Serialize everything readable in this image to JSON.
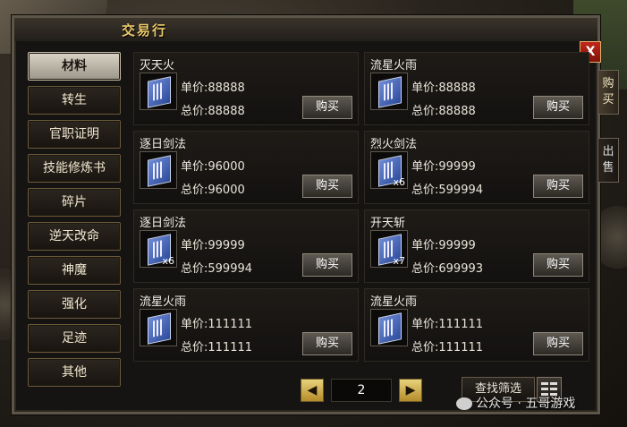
{
  "window": {
    "title": "交易行",
    "close_label": "X"
  },
  "side_tabs": [
    {
      "label": "购买",
      "active": true
    },
    {
      "label": "出售",
      "active": false
    }
  ],
  "categories": [
    {
      "label": "材料",
      "active": true
    },
    {
      "label": "转生",
      "active": false
    },
    {
      "label": "官职证明",
      "active": false
    },
    {
      "label": "技能修炼书",
      "active": false
    },
    {
      "label": "碎片",
      "active": false
    },
    {
      "label": "逆天改命",
      "active": false
    },
    {
      "label": "神魔",
      "active": false
    },
    {
      "label": "强化",
      "active": false
    },
    {
      "label": "足迹",
      "active": false
    },
    {
      "label": "其他",
      "active": false
    }
  ],
  "labels": {
    "unit_price": "单价:",
    "total_price": "总价:",
    "buy": "购买"
  },
  "listings": [
    {
      "name": "灭天火",
      "icon": "skill-book-icon",
      "qty": "",
      "unit_price": "88888",
      "total_price": "88888"
    },
    {
      "name": "流星火雨",
      "icon": "skill-book-icon",
      "qty": "",
      "unit_price": "88888",
      "total_price": "88888"
    },
    {
      "name": "逐日剑法",
      "icon": "skill-book-icon",
      "qty": "",
      "unit_price": "96000",
      "total_price": "96000"
    },
    {
      "name": "烈火剑法",
      "icon": "skill-book-icon",
      "qty": "x6",
      "unit_price": "99999",
      "total_price": "599994"
    },
    {
      "name": "逐日剑法",
      "icon": "skill-book-icon",
      "qty": "x6",
      "unit_price": "99999",
      "total_price": "599994"
    },
    {
      "name": "开天斩",
      "icon": "skill-book-icon",
      "qty": "x7",
      "unit_price": "99999",
      "total_price": "699993"
    },
    {
      "name": "流星火雨",
      "icon": "skill-book-icon",
      "qty": "",
      "unit_price": "111111",
      "total_price": "111111"
    },
    {
      "name": "流星火雨",
      "icon": "skill-book-icon",
      "qty": "",
      "unit_price": "111111",
      "total_price": "111111"
    }
  ],
  "pager": {
    "current_page": "2",
    "prev_icon": "◀",
    "next_icon": "▶"
  },
  "filter": {
    "label": "查找筛选"
  },
  "watermark": {
    "text": "公众号 · 五哥游戏"
  },
  "colors": {
    "title": "#e9c86a",
    "active_tab": "#d9d3c6",
    "close": "#c3261a",
    "arrow": "#e7d27a",
    "book": "#2c4b9a"
  }
}
